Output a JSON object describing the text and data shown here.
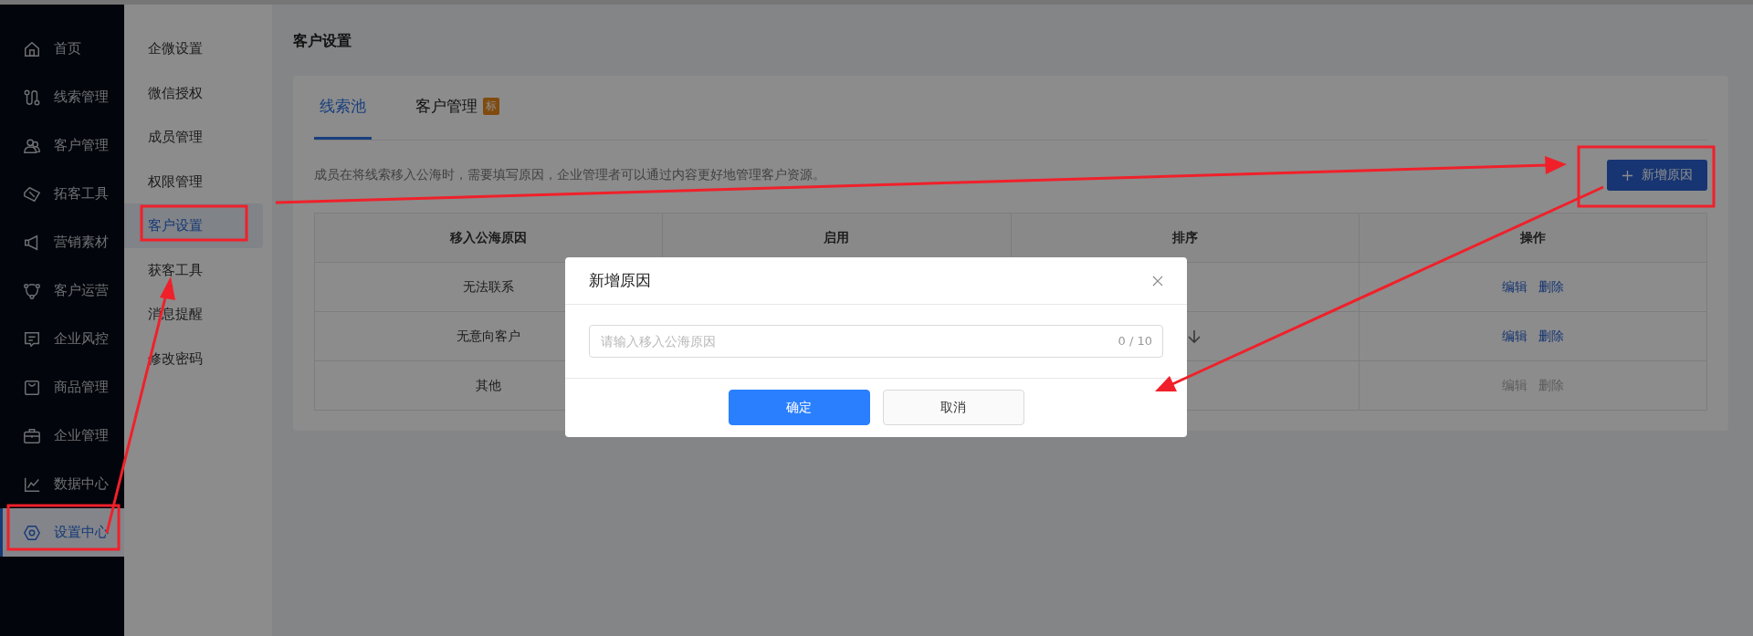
{
  "sidebar": {
    "items": [
      {
        "label": "首页",
        "selected": false
      },
      {
        "label": "线索管理",
        "selected": false
      },
      {
        "label": "客户管理",
        "selected": false
      },
      {
        "label": "拓客工具",
        "selected": false
      },
      {
        "label": "营销素材",
        "selected": false
      },
      {
        "label": "客户运营",
        "selected": false
      },
      {
        "label": "企业风控",
        "selected": false
      },
      {
        "label": "商品管理",
        "selected": false
      },
      {
        "label": "企业管理",
        "selected": false
      },
      {
        "label": "数据中心",
        "selected": false
      },
      {
        "label": "设置中心",
        "selected": true
      }
    ]
  },
  "submenu": {
    "items": [
      {
        "label": "企微设置",
        "selected": false
      },
      {
        "label": "微信授权",
        "selected": false
      },
      {
        "label": "成员管理",
        "selected": false
      },
      {
        "label": "权限管理",
        "selected": false
      },
      {
        "label": "客户设置",
        "selected": true
      },
      {
        "label": "获客工具",
        "selected": false
      },
      {
        "label": "消息提醒",
        "selected": false
      },
      {
        "label": "修改密码",
        "selected": false
      }
    ]
  },
  "page": {
    "title": "客户设置"
  },
  "tabs": [
    {
      "label": "线索池",
      "selected": true
    },
    {
      "label": "客户管理",
      "selected": false,
      "badge": "标"
    }
  ],
  "description": "成员在将线索移入公海时，需要填写原因，企业管理者可以通过内容更好地管理客户资源。",
  "add_button": {
    "label": "新增原因"
  },
  "table": {
    "columns": [
      "移入公海原因",
      "启用",
      "排序",
      "操作"
    ],
    "rows": [
      {
        "reason": "无法联系",
        "actions": [
          {
            "label": "编辑",
            "disabled": false
          },
          {
            "label": "删除",
            "disabled": false
          }
        ]
      },
      {
        "reason": "无意向客户",
        "sort_down": true,
        "actions": [
          {
            "label": "编辑",
            "disabled": false
          },
          {
            "label": "删除",
            "disabled": false
          }
        ]
      },
      {
        "reason": "其他",
        "actions": [
          {
            "label": "编辑",
            "disabled": true
          },
          {
            "label": "删除",
            "disabled": true
          }
        ]
      }
    ]
  },
  "dialog": {
    "title": "新增原因",
    "input": {
      "placeholder": "请输入移入公海原因",
      "counter": "0 / 10"
    },
    "buttons": [
      {
        "label": "确定",
        "kind": "primary"
      },
      {
        "label": "取消",
        "kind": "default"
      }
    ]
  }
}
